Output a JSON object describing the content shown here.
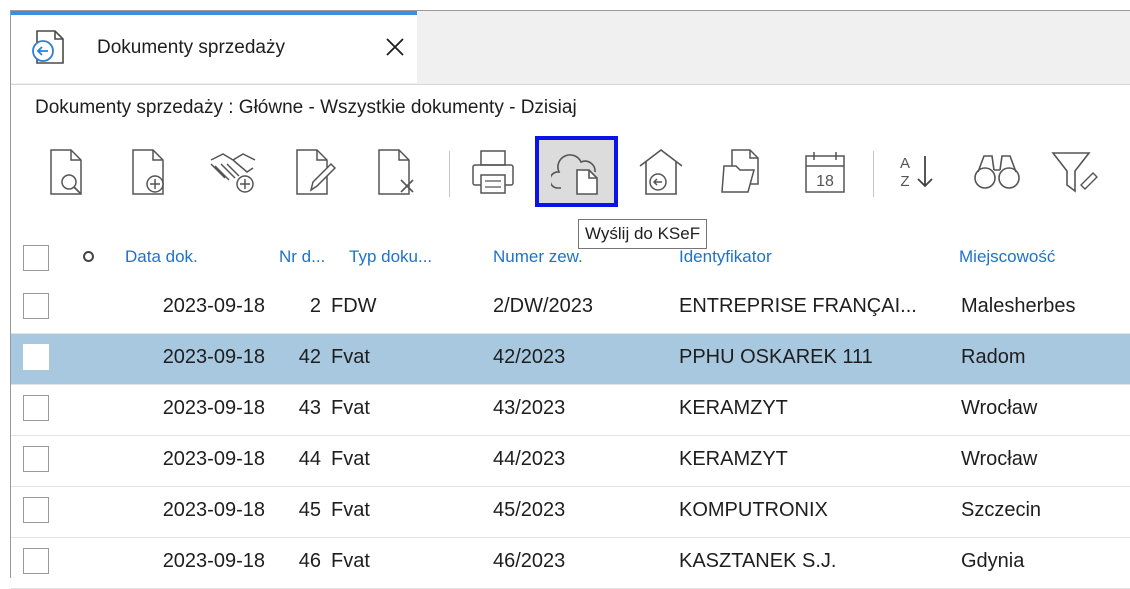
{
  "tab": {
    "label": "Dokumenty sprzedaży",
    "close_icon": "close-icon",
    "icon": "sales-documents-icon"
  },
  "breadcrumb": "Dokumenty sprzedaży : Główne - Wszystkie dokumenty - Dzisiaj",
  "toolbar": {
    "items": [
      {
        "name": "preview-document-icon"
      },
      {
        "name": "add-document-icon"
      },
      {
        "name": "handshake-add-icon"
      },
      {
        "name": "edit-document-icon"
      },
      {
        "name": "delete-document-icon"
      },
      {
        "name": "print-icon"
      },
      {
        "name": "cloud-send-icon"
      },
      {
        "name": "home-import-icon"
      },
      {
        "name": "documents-icon"
      },
      {
        "name": "calendar-icon",
        "text": "18"
      },
      {
        "name": "sort-az-icon",
        "text_top": "A",
        "text_bottom": "Z"
      },
      {
        "name": "binoculars-icon"
      },
      {
        "name": "filter-icon"
      }
    ],
    "tooltip": "Wyślij do KSeF"
  },
  "grid": {
    "columns": [
      "Data dok.",
      "Nr d...",
      "Typ doku...",
      "Numer zew.",
      "Identyfikator",
      "Miejscowość"
    ],
    "rows": [
      {
        "date": "2023-09-18",
        "nr": "2",
        "type": "FDW",
        "ext": "2/DW/2023",
        "id": "ENTREPRISE FRANÇAI...",
        "city": "Malesherbes",
        "selected": false
      },
      {
        "date": "2023-09-18",
        "nr": "42",
        "type": "Fvat",
        "ext": "42/2023",
        "id": "PPHU OSKAREK 111",
        "city": "Radom",
        "selected": true
      },
      {
        "date": "2023-09-18",
        "nr": "43",
        "type": "Fvat",
        "ext": "43/2023",
        "id": "KERAMZYT",
        "city": "Wrocław",
        "selected": false
      },
      {
        "date": "2023-09-18",
        "nr": "44",
        "type": "Fvat",
        "ext": "44/2023",
        "id": "KERAMZYT",
        "city": "Wrocław",
        "selected": false
      },
      {
        "date": "2023-09-18",
        "nr": "45",
        "type": "Fvat",
        "ext": "45/2023",
        "id": "KOMPUTRONIX",
        "city": "Szczecin",
        "selected": false
      },
      {
        "date": "2023-09-18",
        "nr": "46",
        "type": "Fvat",
        "ext": "46/2023",
        "id": "KASZTANEK S.J.",
        "city": "Gdynia",
        "selected": false
      }
    ]
  },
  "colors": {
    "accent": "#3c8ee0",
    "header_text": "#1e73c8",
    "selected_row": "#a8c8e0",
    "highlight_border": "#0a14e6"
  }
}
